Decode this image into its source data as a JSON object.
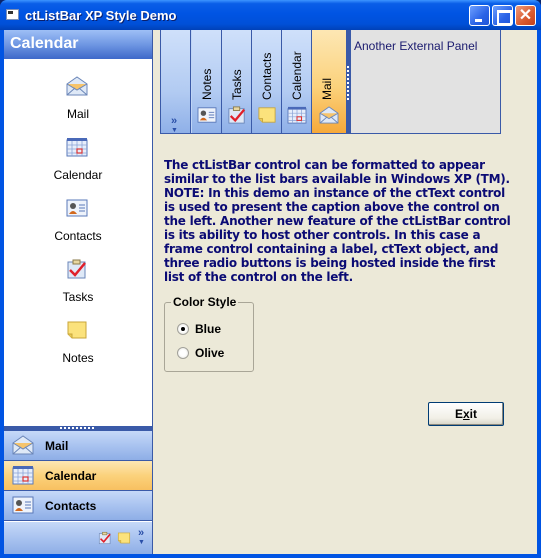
{
  "window": {
    "title": "ctListBar XP Style Demo",
    "controls": {
      "minimize": "minimize",
      "maximize": "maximize",
      "close": "✕"
    }
  },
  "left_listbar": {
    "caption": "Calendar",
    "items": [
      {
        "label": "Mail",
        "icon": "mail-icon"
      },
      {
        "label": "Calendar",
        "icon": "calendar-icon"
      },
      {
        "label": "Contacts",
        "icon": "contacts-icon"
      },
      {
        "label": "Tasks",
        "icon": "tasks-icon"
      },
      {
        "label": "Notes",
        "icon": "notes-icon"
      }
    ],
    "groups": [
      {
        "label": "Mail",
        "icon": "mail-icon",
        "active": false
      },
      {
        "label": "Calendar",
        "icon": "calendar-icon",
        "active": true
      },
      {
        "label": "Contacts",
        "icon": "contacts-icon",
        "active": false
      }
    ],
    "overflow_icons": [
      "tasks-icon",
      "notes-icon"
    ],
    "overflow_chevron": "»"
  },
  "horizontal_listbar": {
    "chevron": "»",
    "tabs": [
      {
        "label": "Notes",
        "icon": "contacts-icon",
        "active": false
      },
      {
        "label": "Tasks",
        "icon": "tasks-icon",
        "active": false
      },
      {
        "label": "Contacts",
        "icon": "notes-icon",
        "active": false
      },
      {
        "label": "Calendar",
        "icon": "calendar-icon",
        "active": false
      },
      {
        "label": "Mail",
        "icon": "mail-icon",
        "active": true
      }
    ]
  },
  "external_panel": {
    "text": "Another External Panel"
  },
  "description": "The ctListBar control can be formatted to appear similar to the list bars available in Windows XP (TM). NOTE: In this demo an instance of the ctText control is used to present the caption above the control on the left. Another new feature of the ctListBar control is its ability to host other controls. In this case a frame control containing a label, ctText object, and three radio buttons is being hosted inside the first list of the control on the left.",
  "color_style": {
    "legend": "Color Style",
    "options": [
      {
        "label": "Blue",
        "selected": true
      },
      {
        "label": "Olive",
        "selected": false
      }
    ]
  },
  "exit_button": {
    "prefix": "E",
    "accel": "x",
    "suffix": "it"
  },
  "colors": {
    "accent_blue": "#0054e3",
    "active_orange": "#fbd27c",
    "text_navy": "#0b0b74"
  }
}
